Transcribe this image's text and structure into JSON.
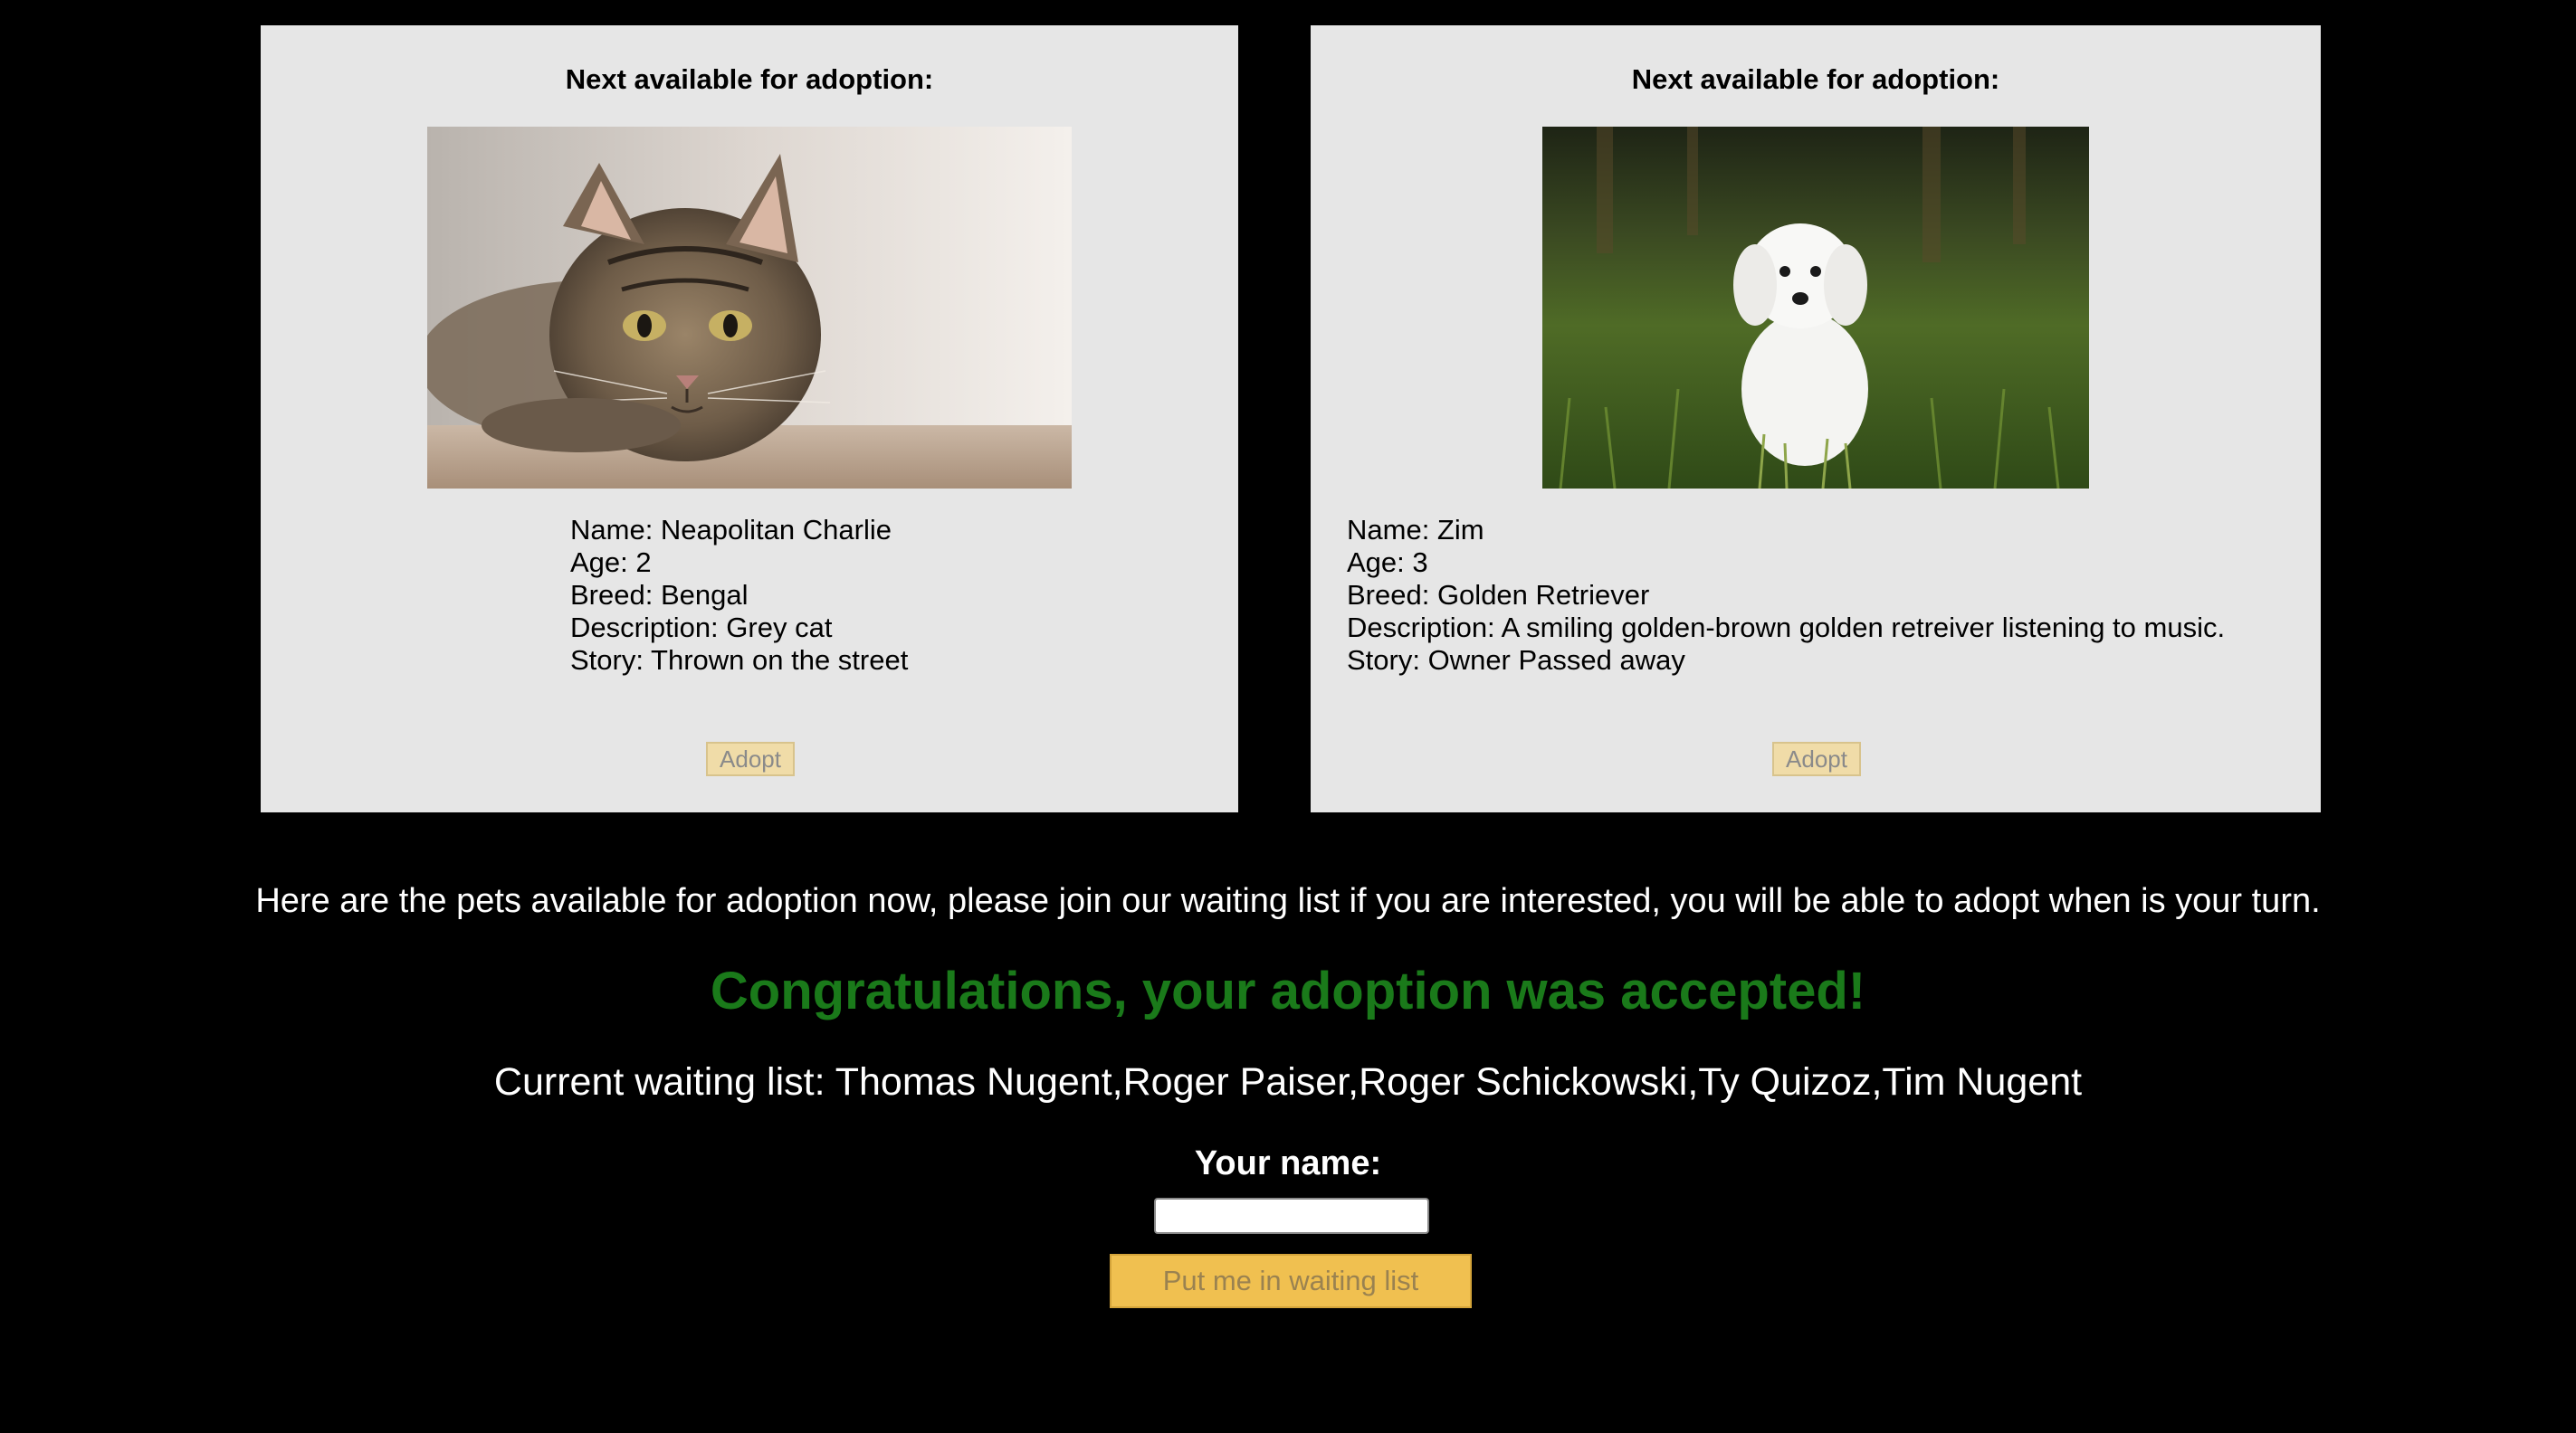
{
  "cards": [
    {
      "heading": "Next available for adoption:",
      "photo_subject": "tabby-cat",
      "name": "Name: Neapolitan Charlie",
      "age": "Age: 2",
      "breed": "Breed: Bengal",
      "description": "Description: Grey cat",
      "story": "Story: Thrown on the street",
      "adopt_label": "Adopt"
    },
    {
      "heading": "Next available for adoption:",
      "photo_subject": "white-dog-in-grass",
      "name": "Name: Zim",
      "age": "Age: 3",
      "breed": "Breed: Golden Retriever",
      "description": "Description: A smiling golden-brown golden retreiver listening to music.",
      "story": "Story: Owner Passed away",
      "adopt_label": "Adopt"
    }
  ],
  "intro": "Here are the pets available for adoption now, please join our waiting list if you are interested, you will be able to adopt when is your turn.",
  "congrats": "Congratulations, your adoption was accepted!",
  "waiting_list": "Current waiting list: Thomas Nugent,Roger Paiser,Roger Schickowski,Ty Quizoz,Tim Nugent",
  "form": {
    "label": "Your name:",
    "input_value": "",
    "submit_label": "Put me in waiting list"
  },
  "colors": {
    "page_background": "#000000",
    "card_background": "#e6e6e6",
    "congrats_text": "#1a7a1a",
    "adopt_button": "#f0dca8",
    "waitlist_button": "#f0c050"
  }
}
